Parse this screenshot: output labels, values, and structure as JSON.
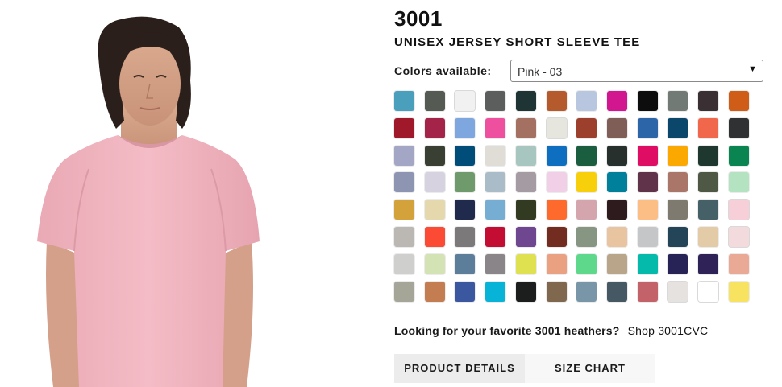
{
  "product": {
    "sku": "3001",
    "name": "UNISEX JERSEY SHORT SLEEVE TEE"
  },
  "colors": {
    "label": "Colors available:",
    "selected_value": "Pink - 03",
    "swatches": [
      "#4a9fbd",
      "#555a52",
      "#f1f1f1",
      "#5c5d5d",
      "#1f3434",
      "#b55a2d",
      "#b8c6e0",
      "#d1168f",
      "#0d0d0d",
      "#727a76",
      "#3a3033",
      "#cf5d17",
      "#a0192b",
      "#a32349",
      "#7ea7e0",
      "#ee4f9e",
      "#a47062",
      "#e6e6df",
      "#9c3f2c",
      "#7e5e57",
      "#2c66a9",
      "#0a476b",
      "#f0674b",
      "#303132",
      "#a4a6c5",
      "#393f33",
      "#004d79",
      "#dfddd6",
      "#a7c6bf",
      "#0e6fc1",
      "#1a5d3f",
      "#27302c",
      "#e00d65",
      "#fba800",
      "#1e382f",
      "#0a8552",
      "#8d95b3",
      "#d6d2e0",
      "#6f9a6b",
      "#a9bcc7",
      "#a59ba2",
      "#f1cfe6",
      "#f8cf0b",
      "#00809b",
      "#60334b",
      "#ab766a",
      "#4f5844",
      "#b3e3c1",
      "#d4a23b",
      "#e5d8ad",
      "#1f2a4d",
      "#76aed3",
      "#333a22",
      "#fd6a2b",
      "#d4a5ad",
      "#2d1b1e",
      "#fcbe84",
      "#7f7a70",
      "#456066",
      "#f6cfd9",
      "#bbb7b3",
      "#fc4b34",
      "#7b7979",
      "#c40d33",
      "#6e4790",
      "#722c20",
      "#879583",
      "#e9c4a0",
      "#c5c6c8",
      "#244457",
      "#e2cba6",
      "#f3dadd",
      "#cfcfce",
      "#d3e3b3",
      "#5c7e9a",
      "#898589",
      "#dfe151",
      "#e9a181",
      "#5ed88b",
      "#b8a58a",
      "#05b9ab",
      "#272356",
      "#2f2256",
      "#e9a995",
      "#a5a598",
      "#c47d50",
      "#3b57a0",
      "#07b4d7",
      "#1c1d1d",
      "#80684e",
      "#7896a8",
      "#455863",
      "#c36268",
      "#e5e2df",
      "#ffffff",
      "#f7e360"
    ],
    "selected_index": 59
  },
  "heathers": {
    "text": "Looking for your favorite 3001 heathers?",
    "link": "Shop 3001CVC"
  },
  "tabs": {
    "product_details": "PRODUCT DETAILS",
    "size_chart": "SIZE CHART"
  },
  "theme": {
    "shirt_color": "#f1b6c1",
    "text_color": "#111111",
    "active_tab_bg": "#ececec"
  }
}
